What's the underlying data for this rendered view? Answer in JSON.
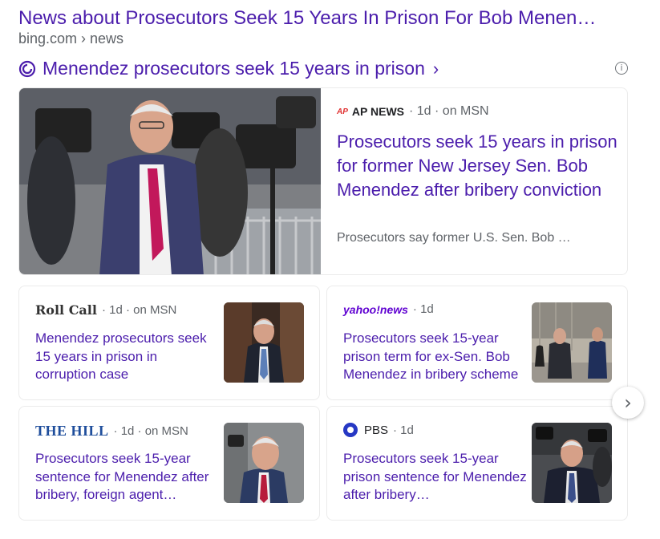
{
  "header": {
    "title": "News about Prosecutors Seek 15 Years In Prison For Bob Menen…",
    "source": "bing.com › news"
  },
  "topic": {
    "label": "Menendez prosecutors seek 15 years in prison",
    "chevron": "›",
    "info": "i"
  },
  "hero": {
    "publisher": "AP NEWS",
    "publisher_badge": "AP",
    "meta": "· 1d · on MSN",
    "title": "Prosecutors seek 15 years in prison for former New Jersey Sen. Bob Menendez after bribery conviction",
    "snippet": "Prosecutors say former U.S. Sen. Bob …"
  },
  "cards": [
    {
      "publisher": "Roll Call",
      "meta": "· 1d · on MSN",
      "title": "Menendez prosecutors seek 15 years in prison in corruption case"
    },
    {
      "publisher": "yahoo!news",
      "meta": "· 1d",
      "title": "Prosecutors seek 15-year prison term for ex-Sen. Bob Menendez in bribery scheme"
    },
    {
      "publisher": "THE HILL",
      "meta": "· 1d · on MSN",
      "title": "Prosecutors seek 15-year sentence for Menendez after bribery, foreign agent…"
    },
    {
      "publisher": "PBS",
      "meta": "· 1d",
      "title": "Prosecutors seek 15-year prison sentence for Menendez after bribery…"
    }
  ],
  "nav": {
    "next": "›"
  },
  "colors": {
    "link": "#4b1dac",
    "meta": "#5f6368",
    "border": "#ebebeb"
  }
}
